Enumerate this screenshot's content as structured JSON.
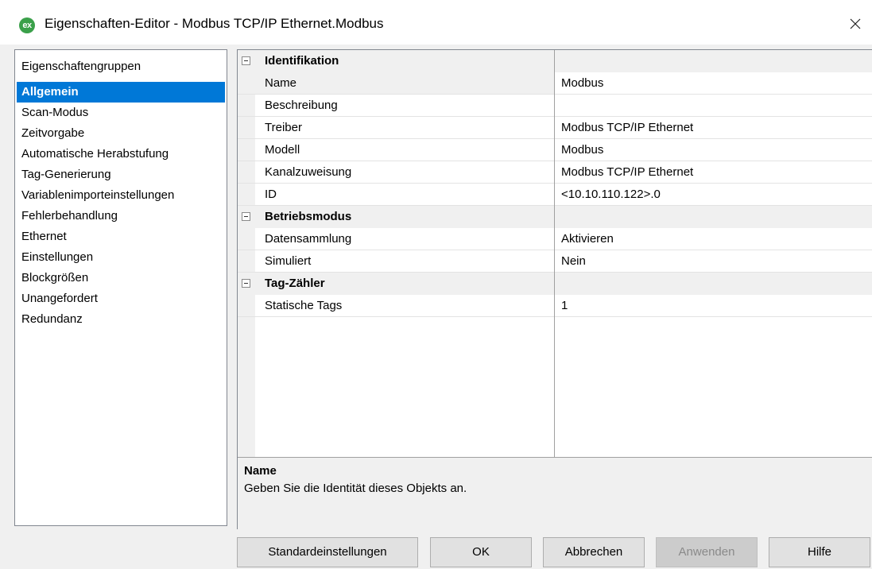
{
  "window": {
    "icon_label": "ex",
    "title": "Eigenschaften-Editor - Modbus TCP/IP Ethernet.Modbus"
  },
  "groups": {
    "header": "Eigenschaftengruppen",
    "items": [
      {
        "label": "Allgemein",
        "selected": true
      },
      {
        "label": "Scan-Modus"
      },
      {
        "label": "Zeitvorgabe"
      },
      {
        "label": "Automatische Herabstufung"
      },
      {
        "label": "Tag-Generierung"
      },
      {
        "label": "Variablenimporteinstellungen"
      },
      {
        "label": "Fehlerbehandlung"
      },
      {
        "label": "Ethernet"
      },
      {
        "label": "Einstellungen"
      },
      {
        "label": "Blockgrößen"
      },
      {
        "label": "Unangefordert"
      },
      {
        "label": "Redundanz"
      }
    ]
  },
  "properties": {
    "cat1": {
      "label": "Identifikation"
    },
    "name": {
      "name": "Name",
      "value": "Modbus"
    },
    "beschreibung": {
      "name": "Beschreibung",
      "value": ""
    },
    "treiber": {
      "name": "Treiber",
      "value": "Modbus TCP/IP Ethernet"
    },
    "modell": {
      "name": "Modell",
      "value": "Modbus"
    },
    "kanal": {
      "name": "Kanalzuweisung",
      "value": "Modbus TCP/IP Ethernet"
    },
    "id": {
      "name": "ID",
      "value": "<10.10.110.122>.0"
    },
    "cat2": {
      "label": "Betriebsmodus"
    },
    "daten": {
      "name": "Datensammlung",
      "value": "Aktivieren"
    },
    "simuliert": {
      "name": "Simuliert",
      "value": "Nein"
    },
    "cat3": {
      "label": "Tag-Zähler"
    },
    "statisch": {
      "name": "Statische Tags",
      "value": "1"
    }
  },
  "description": {
    "title": "Name",
    "text": "Geben Sie die Identität dieses Objekts an."
  },
  "buttons": {
    "defaults": "Standardeinstellungen",
    "ok": "OK",
    "cancel": "Abbrechen",
    "apply": "Anwenden",
    "help": "Hilfe"
  }
}
